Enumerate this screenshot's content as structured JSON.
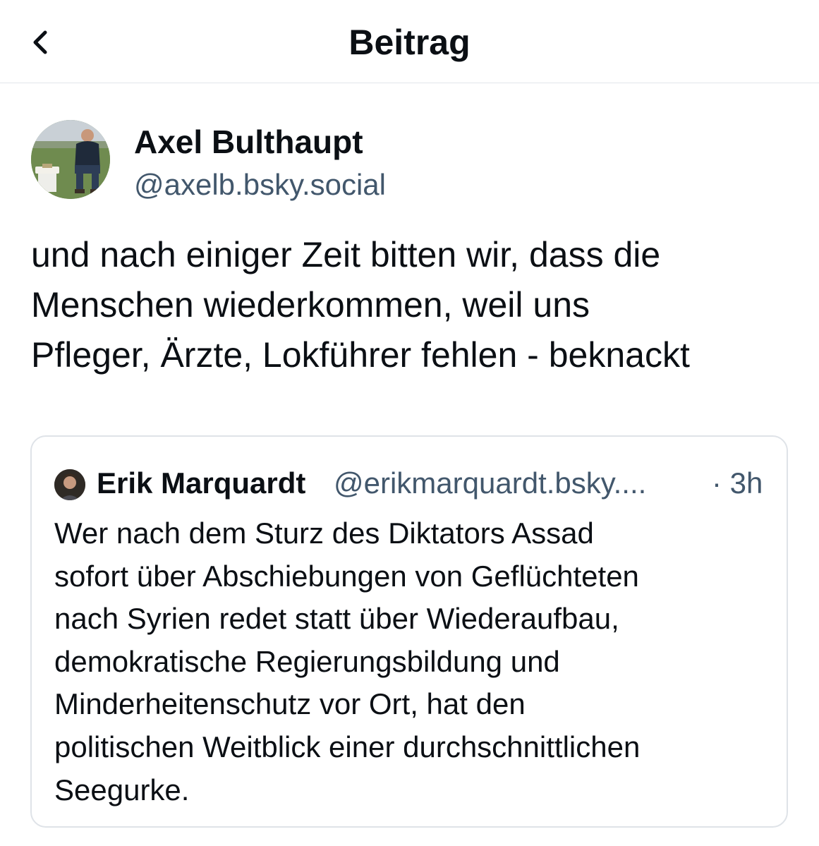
{
  "header": {
    "title": "Beitrag",
    "back_icon": "chevron-left-icon"
  },
  "post": {
    "author": {
      "name": "Axel Bulthaupt",
      "handle": "@axelb.bsky.social"
    },
    "text_lines": [
      "und nach einiger Zeit bitten wir, dass die",
      "Menschen wiederkommen, weil uns",
      "Pfleger, Ärzte, Lokführer fehlen - beknackt"
    ]
  },
  "quote": {
    "author": {
      "name": "Erik Marquardt",
      "handle": "@erikmarquardt.bsky....",
      "time": "· 3h"
    },
    "text_lines": [
      "Wer nach dem Sturz des Diktators Assad",
      "sofort über Abschiebungen von Geflüchteten",
      "nach Syrien redet statt über Wiederaufbau,",
      "demokratische Regierungsbildung und",
      "Minderheitenschutz vor Ort, hat den",
      "politischen Weitblick einer durchschnittlichen",
      "Seegurke."
    ]
  },
  "colors": {
    "text": "#0b0f14",
    "secondary_text": "#42576c",
    "border": "#dfe3e8"
  }
}
